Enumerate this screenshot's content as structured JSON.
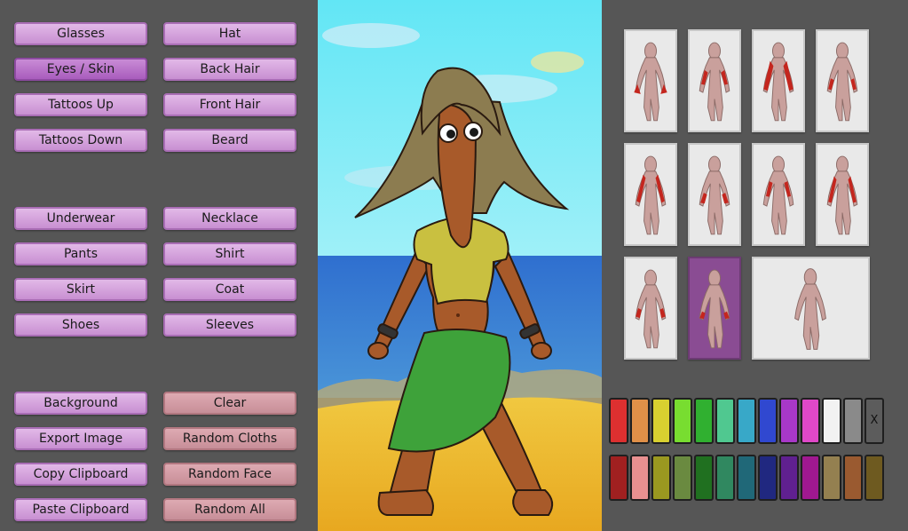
{
  "buttons": {
    "glasses": "Glasses",
    "hat": "Hat",
    "eyes_skin": "Eyes / Skin",
    "back_hair": "Back Hair",
    "tattoos_up": "Tattoos Up",
    "front_hair": "Front Hair",
    "tattoos_down": "Tattoos Down",
    "beard": "Beard",
    "underwear": "Underwear",
    "necklace": "Necklace",
    "pants": "Pants",
    "shirt": "Shirt",
    "skirt": "Skirt",
    "coat": "Coat",
    "shoes": "Shoes",
    "sleeves": "Sleeves",
    "background": "Background",
    "clear": "Clear",
    "export_image": "Export Image",
    "random_cloths": "Random Cloths",
    "copy_clipboard": "Copy Clipboard",
    "random_face": "Random Face",
    "paste_clipboard": "Paste Clipboard",
    "random_all": "Random All"
  },
  "selected_category": "Eyes / Skin",
  "palette": {
    "row1": [
      "#dd3030",
      "#e09048",
      "#d8d030",
      "#78dd30",
      "#30b030",
      "#50c890",
      "#38a8c8",
      "#3048d0",
      "#a838c8",
      "#e048c8",
      "#f2f2f2",
      "#8a8a8a"
    ],
    "row2": [
      "#a02020",
      "#e89090",
      "#9a9820",
      "#6a8a40",
      "#207020",
      "#308860",
      "#206878",
      "#202880",
      "#602090",
      "#a01890",
      "#948050",
      "#9a5a30",
      "#6e5a20"
    ],
    "close_label": "X"
  }
}
